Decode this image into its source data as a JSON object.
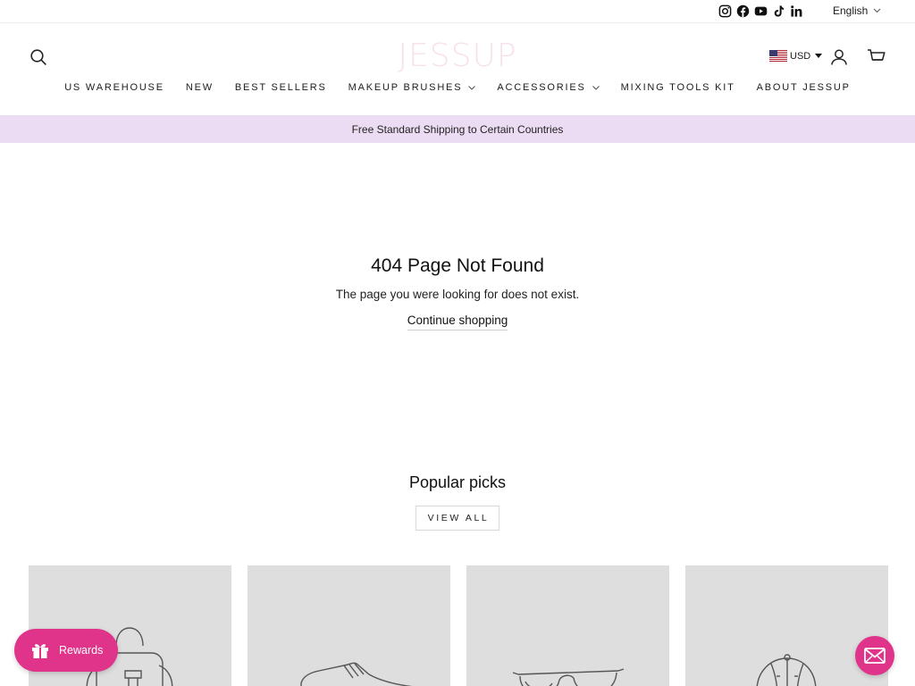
{
  "topbar": {
    "social_icons": [
      "instagram-icon",
      "facebook-icon",
      "youtube-icon",
      "tiktok-icon",
      "linkedin-icon"
    ],
    "language": "English"
  },
  "header": {
    "logo": "JESSUP",
    "currency": "USD",
    "nav": [
      {
        "label": "US WAREHOUSE",
        "dropdown": false
      },
      {
        "label": "NEW",
        "dropdown": false
      },
      {
        "label": "BEST SELLERS",
        "dropdown": false
      },
      {
        "label": "MAKEUP BRUSHES",
        "dropdown": true
      },
      {
        "label": "ACCESSORIES",
        "dropdown": true
      },
      {
        "label": "MIXING TOOLS KIT",
        "dropdown": false
      },
      {
        "label": "ABOUT JESSUP",
        "dropdown": false
      }
    ]
  },
  "announcement": "Free Standard Shipping to Certain Countries",
  "error": {
    "title": "404 Page Not Found",
    "text": "The page you were looking for does not exist.",
    "continue": "Continue shopping"
  },
  "picks": {
    "title": "Popular picks",
    "view_all": "VIEW ALL",
    "placeholders": [
      "backpack-placeholder-icon",
      "sneaker-placeholder-icon",
      "sunglasses-placeholder-icon",
      "cap-placeholder-icon"
    ]
  },
  "widgets": {
    "rewards": "Rewards"
  },
  "colors": {
    "accent": "#e0338a",
    "announcement_bg": "#ecdcf3",
    "logo": "#f6e1ec",
    "placeholder_bg": "#dedede"
  }
}
